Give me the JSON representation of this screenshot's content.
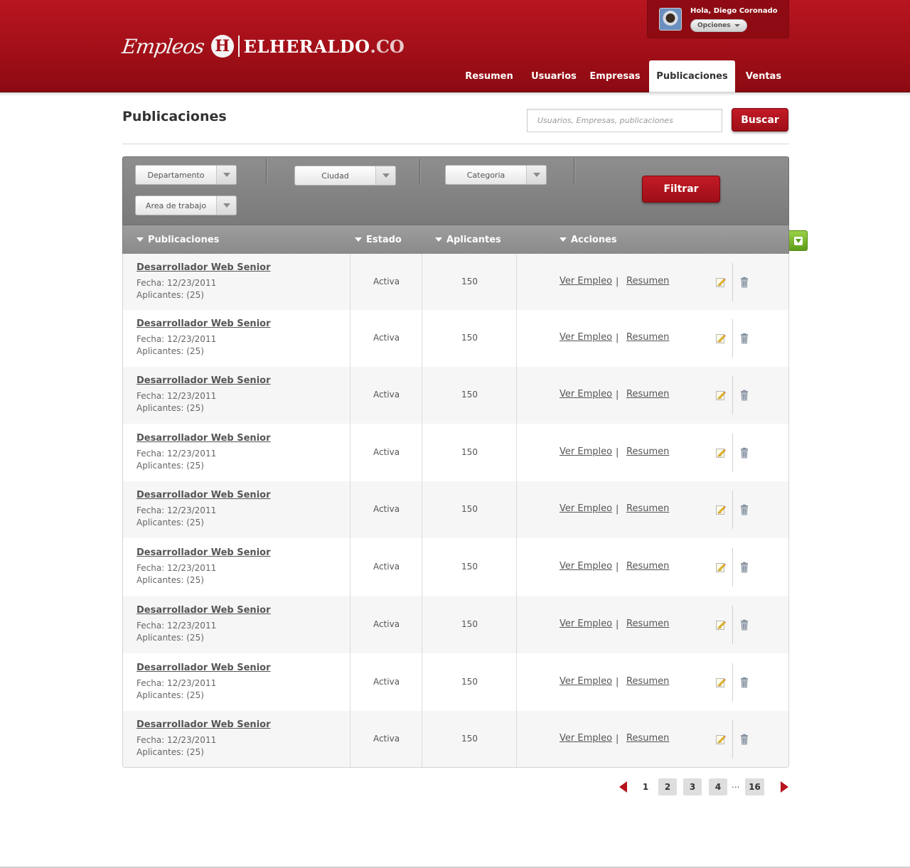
{
  "brand": {
    "script": "Empleos",
    "monogram": "H",
    "name": "ELHERALDO",
    "tld": ".CO"
  },
  "user": {
    "greeting": "Hola, Diego Coronado",
    "options_label": "Opciones"
  },
  "nav": [
    {
      "label": "Resumen",
      "active": false
    },
    {
      "label": "Usuarios",
      "active": false
    },
    {
      "label": "Empresas",
      "active": false
    },
    {
      "label": "Publicaciones",
      "active": true
    },
    {
      "label": "Ventas",
      "active": false
    }
  ],
  "page": {
    "title": "Publicaciones"
  },
  "search": {
    "placeholder": "Usuarios, Empresas, publicaciones",
    "button": "Buscar"
  },
  "filters": {
    "departamento": "Departamento",
    "ciudad": "Ciudad",
    "categoria": "Categoria",
    "area": "Area de trabajo",
    "button": "Filtrar"
  },
  "table": {
    "headers": {
      "publicaciones": "Publicaciones",
      "estado": "Estado",
      "aplicantes": "Aplicantes",
      "acciones": "Acciones"
    },
    "rows": [
      {
        "title": "Desarrollador Web Senior",
        "fecha": "Fecha: 12/23/2011",
        "aplicantes_txt": "Aplicantes: (25)",
        "estado": "Activa",
        "aplicantes": "150",
        "ver": "Ver Empleo",
        "sep": "|",
        "resumen": "Resumen"
      },
      {
        "title": "Desarrollador Web Senior",
        "fecha": "Fecha: 12/23/2011",
        "aplicantes_txt": "Aplicantes: (25)",
        "estado": "Activa",
        "aplicantes": "150",
        "ver": "Ver Empleo",
        "sep": "|",
        "resumen": "Resumen"
      },
      {
        "title": "Desarrollador Web Senior",
        "fecha": "Fecha: 12/23/2011",
        "aplicantes_txt": "Aplicantes: (25)",
        "estado": "Activa",
        "aplicantes": "150",
        "ver": "Ver Empleo",
        "sep": "|",
        "resumen": "Resumen"
      },
      {
        "title": "Desarrollador Web Senior",
        "fecha": "Fecha: 12/23/2011",
        "aplicantes_txt": "Aplicantes: (25)",
        "estado": "Activa",
        "aplicantes": "150",
        "ver": "Ver Empleo",
        "sep": "|",
        "resumen": "Resumen"
      },
      {
        "title": "Desarrollador Web Senior",
        "fecha": "Fecha: 12/23/2011",
        "aplicantes_txt": "Aplicantes: (25)",
        "estado": "Activa",
        "aplicantes": "150",
        "ver": "Ver Empleo",
        "sep": "|",
        "resumen": "Resumen"
      },
      {
        "title": "Desarrollador Web Senior",
        "fecha": "Fecha: 12/23/2011",
        "aplicantes_txt": "Aplicantes: (25)",
        "estado": "Activa",
        "aplicantes": "150",
        "ver": "Ver Empleo",
        "sep": "|",
        "resumen": "Resumen"
      },
      {
        "title": "Desarrollador Web Senior",
        "fecha": "Fecha: 12/23/2011",
        "aplicantes_txt": "Aplicantes: (25)",
        "estado": "Activa",
        "aplicantes": "150",
        "ver": "Ver Empleo",
        "sep": "|",
        "resumen": "Resumen"
      },
      {
        "title": "Desarrollador Web Senior",
        "fecha": "Fecha: 12/23/2011",
        "aplicantes_txt": "Aplicantes: (25)",
        "estado": "Activa",
        "aplicantes": "150",
        "ver": "Ver Empleo",
        "sep": "|",
        "resumen": "Resumen"
      },
      {
        "title": "Desarrollador Web Senior",
        "fecha": "Fecha: 12/23/2011",
        "aplicantes_txt": "Aplicantes: (25)",
        "estado": "Activa",
        "aplicantes": "150",
        "ver": "Ver Empleo",
        "sep": "|",
        "resumen": "Resumen"
      }
    ]
  },
  "pagination": {
    "current": "1",
    "pages": [
      "2",
      "3",
      "4"
    ],
    "ellipsis": "...",
    "last": "16"
  },
  "icons": {
    "edit": "pencil-note-icon",
    "delete": "trash-icon",
    "export": "download-icon",
    "prev": "arrow-left-icon",
    "next": "arrow-right-icon"
  },
  "colors": {
    "brand_red": "#a4101a",
    "button_red": "#b81620",
    "export_green": "#7ab632",
    "header_gray": "#8e8e8e"
  }
}
